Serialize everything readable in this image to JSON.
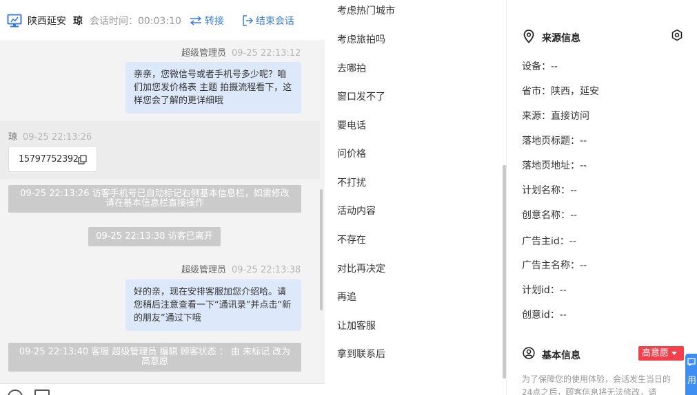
{
  "header": {
    "location": "陕西延安",
    "visitor_name": "琼",
    "session_time_label": "会话时间：",
    "session_time": "00:03:10",
    "transfer_label": "转接",
    "end_session_label": "结束会话"
  },
  "messages": {
    "m1": {
      "sender": "超级管理员",
      "time": "09-25 22:13:12",
      "text": "亲亲，您微信号或者手机号多少呢？咱们加您发价格表 主题 拍摄流程看下，这样您会了解的更详细哦"
    },
    "m2": {
      "sender": "琼",
      "time": "09-25 22:13:26",
      "text": "15797752392"
    },
    "sys1": "09-25 22:13:26 访客手机号已自动标记右侧基本信息栏，如需修改请在基本信息栏直接操作",
    "sys2": "09-25 22:13:38 访客已离开",
    "m3": {
      "sender": "超级管理员",
      "time": "09-25 22:13:38",
      "text": "好的亲，现在安排客服加您介绍哈。请您稍后注意查看一下“通讯录”并点击“新的朋友”通过下哦"
    },
    "sys3": "09-25 22:13:40 客服 超级管理员 编辑 顾客状态 ： 由 未标记 改为 高意愿"
  },
  "quick_replies": [
    "考虑热门城市",
    "考虑旅拍吗",
    "去哪拍",
    "窗口发不了",
    "要电话",
    "问价格",
    "不打扰",
    "活动内容",
    "不存在",
    "对比再决定",
    "再追",
    "让加客服",
    "拿到联系后"
  ],
  "source_info": {
    "title": "来源信息",
    "rows": [
      "设备：--",
      "省市：陕西，延安",
      "来源：直接访问",
      "落地页标题：--",
      "落地页地址：--",
      "计划名称：--",
      "创意名称：--",
      "广告主id：--",
      "广告主名称：--",
      "计划id：--",
      "创意id：--"
    ]
  },
  "basic_info": {
    "title": "基本信息",
    "intent_tag": "高意愿",
    "notice": "为了保障您的使用体验，会话发生当日的24点之后，顾客信息将无法修改，请"
  },
  "side_button_label": "用",
  "colors": {
    "accent": "#3a7cd8",
    "tag": "#f2404c",
    "bubble": "#dde9fb",
    "system": "#cbcbcb",
    "topline": "#f5c400"
  }
}
